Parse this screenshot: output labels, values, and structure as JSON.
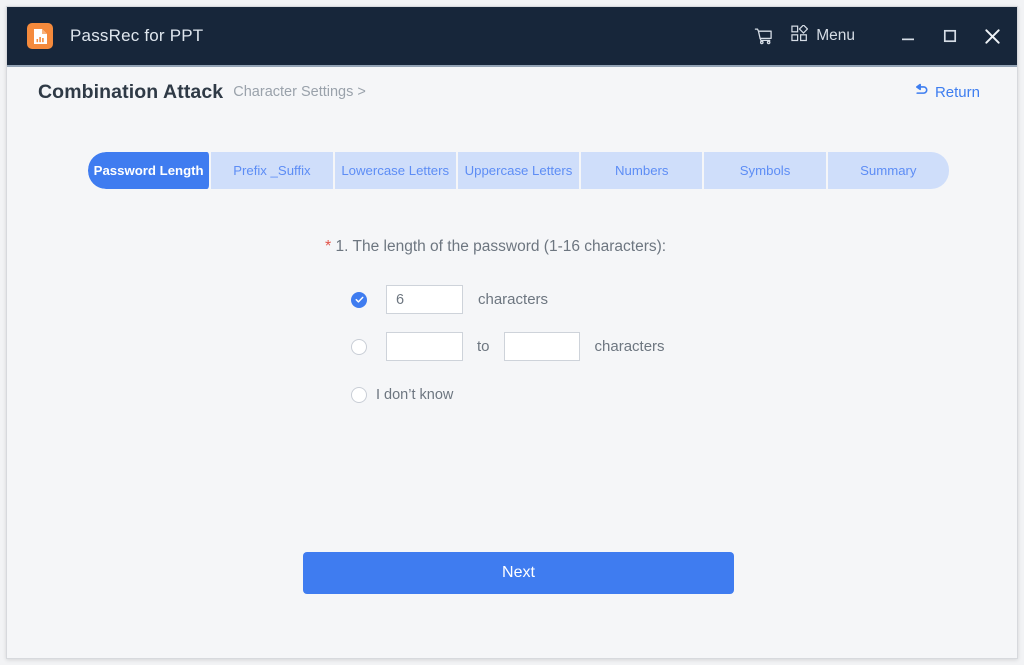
{
  "window": {
    "app_title": "PassRec for PPT",
    "app_icon": "document-chart-icon",
    "controls": {
      "cart": "cart-icon",
      "menu_icon": "grid-menu-icon",
      "menu_label": "Menu",
      "minimize": "minimize-icon",
      "maximize": "maximize-icon",
      "close": "close-icon"
    },
    "colors": {
      "titlebar": "#17263a",
      "accent": "#3f7cf0",
      "tab_inactive": "#cfdefa",
      "app_icon": "#f58a3c",
      "required": "#e2544a"
    }
  },
  "header": {
    "title": "Combination Attack",
    "breadcrumb": "Character Settings >",
    "return_label": "Return",
    "return_icon": "back-arrow-icon"
  },
  "tabs": [
    {
      "label": "Password Length",
      "active": true
    },
    {
      "label": "Prefix _Suffix",
      "active": false
    },
    {
      "label": "Lowercase Letters",
      "active": false
    },
    {
      "label": "Uppercase Letters",
      "active": false
    },
    {
      "label": "Numbers",
      "active": false
    },
    {
      "label": "Symbols",
      "active": false
    },
    {
      "label": "Summary",
      "active": false
    }
  ],
  "form": {
    "required_marker": "*",
    "question": "1. The length of the password (1-16 characters):",
    "options": {
      "exact": {
        "selected": true,
        "value": "6",
        "placeholder": "",
        "unit": "characters"
      },
      "range": {
        "selected": false,
        "min_value": "",
        "max_value": "",
        "min_placeholder": "",
        "max_placeholder": "",
        "separator": "to",
        "unit": "characters"
      },
      "unknown": {
        "selected": false,
        "label": "I don’t know"
      }
    },
    "submit_label": "Next"
  }
}
